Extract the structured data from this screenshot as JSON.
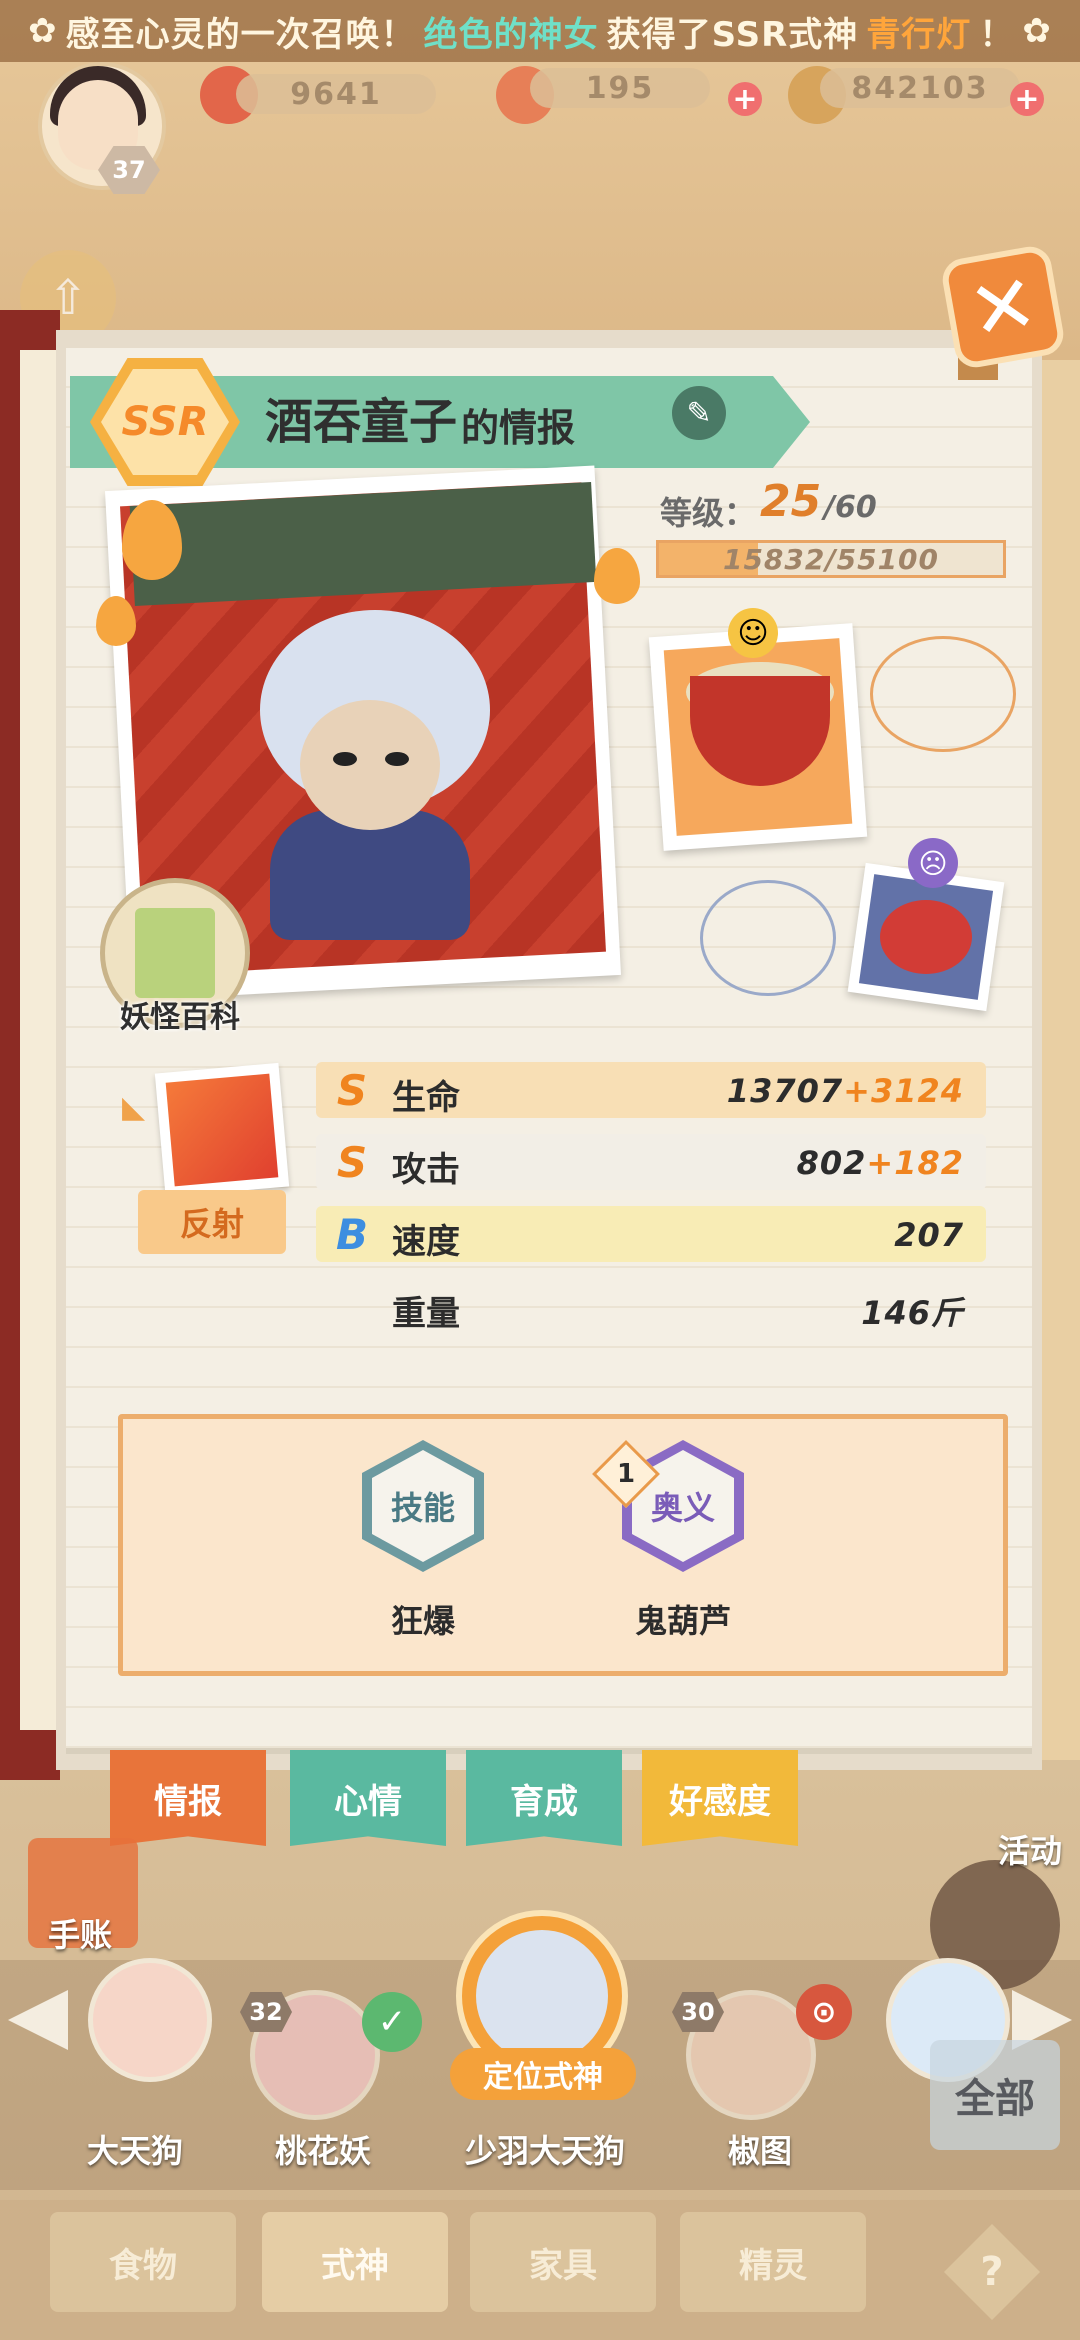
{
  "ticker": {
    "prefix": "感至心灵的一次召唤！",
    "player": "绝色的神女",
    "middle": "获得了SSR式神",
    "shikigami": "青行灯",
    "suffix": "！"
  },
  "resources": {
    "currency_1": "9641",
    "currency_2": "195",
    "currency_3": "842103"
  },
  "player": {
    "level": "37"
  },
  "card": {
    "rarity": "SSR",
    "name": "酒吞童子",
    "title_suffix": "的情报",
    "level_label": "等级：",
    "level": "25",
    "level_max": "/60",
    "exp_text": "15832/55100",
    "exp_fraction": 0.287,
    "encyclopedia_label": "妖怪百科",
    "trait_label": "反射",
    "stats": [
      {
        "grade": "S",
        "name": "生命",
        "base": "13707",
        "bonus": "+3124"
      },
      {
        "grade": "S",
        "name": "攻击",
        "base": "802",
        "bonus": "+182"
      },
      {
        "grade": "B",
        "name": "速度",
        "base": "207",
        "bonus": ""
      },
      {
        "grade": "",
        "name": "重量",
        "base": "146斤",
        "bonus": ""
      }
    ],
    "skills": [
      {
        "badge": "技能",
        "name": "狂爆"
      },
      {
        "badge": "奥义",
        "name": "鬼葫芦",
        "level": "1"
      }
    ]
  },
  "tabs": [
    "情报",
    "心情",
    "育成",
    "好感度"
  ],
  "roster": {
    "side_left_label": "手账",
    "side_right_label": "活动",
    "locate_label": "定位式神",
    "levels": {
      "peach": "32",
      "seal": "30"
    },
    "names": [
      "大天狗",
      "桃花妖",
      "少羽大天狗",
      "椒图"
    ],
    "all_label": "全部"
  },
  "bottom_nav": [
    "食物",
    "式神",
    "家具",
    "精灵"
  ],
  "colors": {
    "accent_orange": "#f0841f",
    "ribbon_green": "#7fc6a7",
    "tab_active": "#e8743a",
    "tab_teal": "#5ab9a0",
    "tab_yellow": "#f2b93a"
  }
}
